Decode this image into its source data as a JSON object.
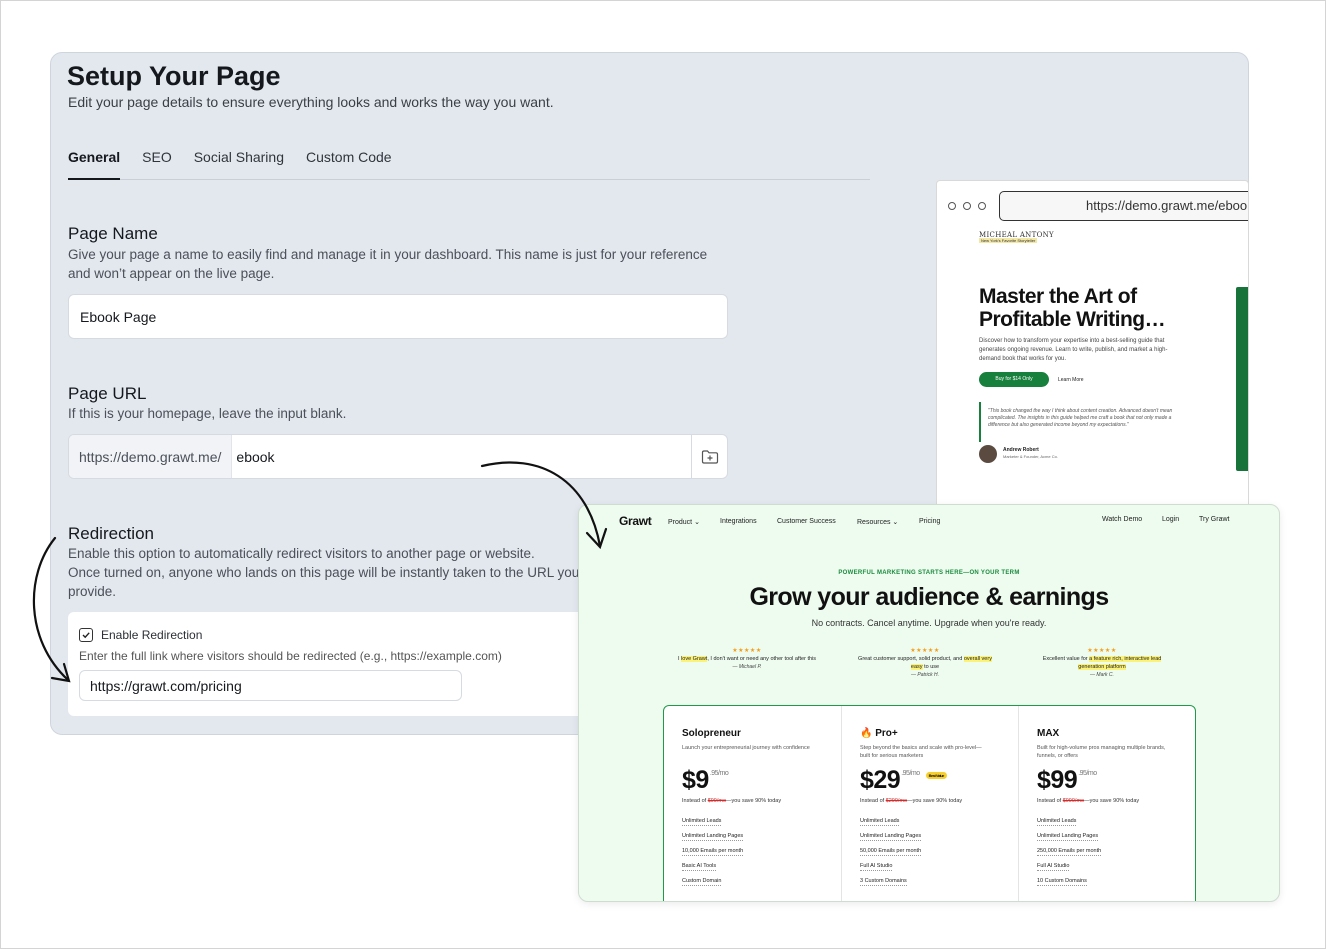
{
  "header": {
    "title": "Setup Your Page",
    "subtitle": "Edit your page details to ensure everything looks and works the way you want."
  },
  "tabs": [
    {
      "label": "General",
      "active": true
    },
    {
      "label": "SEO",
      "active": false
    },
    {
      "label": "Social Sharing",
      "active": false
    },
    {
      "label": "Custom Code",
      "active": false
    }
  ],
  "page_name": {
    "heading": "Page Name",
    "description": "Give your page a name to easily find and manage it in your dashboard. This name is just for your reference and won’t appear on the live page.",
    "value": "Ebook Page"
  },
  "page_url": {
    "heading": "Page URL",
    "description": "If this is your homepage, leave the input blank.",
    "prefix": "https://demo.grawt.me/",
    "value": "ebook",
    "button_icon": "folder-plus-icon"
  },
  "redirection": {
    "heading": "Redirection",
    "description_1": "Enable this option to automatically redirect visitors to another page or website.",
    "description_2": "Once turned on, anyone who lands on this page will be instantly taken to the URL you",
    "description_3": "provide.",
    "checkbox_label": "Enable Redirection",
    "checked": true,
    "hint": "Enter the full link where visitors should be redirected (e.g., https://example.com)",
    "value": "https://grawt.com/pricing"
  },
  "preview_ebook": {
    "address": "https://demo.grawt.me/ebook",
    "brand": "MICHEAL ANTONY",
    "brand_sub": "New York's Favorite Storyteller",
    "headline": "Master the Art of Profitable Writing…",
    "body": "Discover how to transform your expertise into a best-selling guide that generates ongoing revenue. Learn to write, publish, and market a high-demand book that works for you.",
    "cta": "Buy for $14 Only",
    "link": "Learn More",
    "quote": "\"This book changed the way I think about content creation. Advanced doesn't mean complicated. The insights in this guide helped me craft a book that not only made a difference but also generated income beyond my expectations.\"",
    "author": "Andrew Robert",
    "author_role": "Marketer & Founder, Acme Co."
  },
  "preview_pricing": {
    "logo": "Grawt",
    "nav": [
      "Product ⌄",
      "Integrations",
      "Customer Success",
      "Resources ⌄",
      "Pricing"
    ],
    "nav_right": [
      "Watch Demo",
      "Login",
      "Try Grawt"
    ],
    "eyebrow": "POWERFUL MARKETING STARTS HERE—ON YOUR TERM",
    "headline": "Grow your audience & earnings",
    "subheadline": "No contracts. Cancel anytime. Upgrade when you're ready.",
    "testimonials": [
      {
        "stars": "★★★★★",
        "pre": "I ",
        "hl": "love Grawt",
        "post": ", I don't want or need any other tool after this",
        "author": "— Michael P."
      },
      {
        "stars": "★★★★★",
        "pre": "Great customer support, solid product, and ",
        "hl": "overall very easy",
        "post": " to use",
        "author": "— Patrick H."
      },
      {
        "stars": "★★★★★",
        "pre": "Excellent value for ",
        "hl": "a feature rich, interactive lead generation platform",
        "post": "",
        "author": "— Mark C."
      }
    ],
    "plans": [
      {
        "name": "Solopreneur",
        "desc": "Launch your entrepreneurial journey with confidence",
        "price": "$9",
        "cents": ".95/mo",
        "badge": "",
        "was_pre": "Instead of ",
        "was": "$99/mo",
        "was_post": "—you save 90% today",
        "features": [
          "Unlimited Leads",
          "Unlimited Landing Pages",
          "10,000 Emails per month",
          "Basic AI Tools",
          "Custom Domain"
        ]
      },
      {
        "name": "🔥 Pro+",
        "desc": "Step beyond the basics and scale with pro-level—built for serious marketers",
        "price": "$29",
        "cents": ".95/mo",
        "badge": "Best Value",
        "was_pre": "Instead of ",
        "was": "$299/mo",
        "was_post": "—you save 90% today",
        "features": [
          "Unlimited Leads",
          "Unlimited Landing Pages",
          "50,000 Emails per month",
          "Full AI Studio",
          "3 Custom Domains"
        ]
      },
      {
        "name": "MAX",
        "desc": "Built for high-volume pros managing multiple brands, funnels, or offers",
        "price": "$99",
        "cents": ".95/mo",
        "badge": "",
        "was_pre": "Instead of ",
        "was": "$999/mo",
        "was_post": "—you save 90% today",
        "features": [
          "Unlimited Leads",
          "Unlimited Landing Pages",
          "250,000 Emails per month",
          "Full AI Studio",
          "10 Custom Domains"
        ]
      }
    ]
  },
  "colors": {
    "panel_bg": "#e3e8ef",
    "accent_green": "#16803c",
    "preview_bg": "#eefbef"
  }
}
